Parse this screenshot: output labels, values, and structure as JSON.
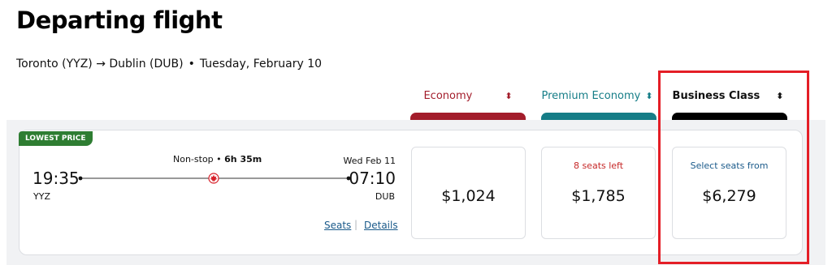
{
  "page": {
    "title": "Departing flight",
    "route": "Toronto (YYZ) → Dublin (DUB)",
    "route_sep": "•",
    "date": "Tuesday, February 10"
  },
  "columns": [
    {
      "label": "Economy",
      "sort_icon": "sort-updown-icon",
      "color": "#a31d2b"
    },
    {
      "label": "Premium Economy",
      "sort_icon": "sort-updown-icon",
      "color": "#157d87"
    },
    {
      "label": "Business Class",
      "sort_icon": "sort-updown-icon",
      "color": "#000000"
    }
  ],
  "flight": {
    "badge": "LOWEST PRICE",
    "stops": "Non-stop",
    "stops_sep": "•",
    "duration": "6h 35m",
    "arrival_date": "Wed Feb 11",
    "departure_time": "19:35",
    "departure_code": "YYZ",
    "arrival_time": "07:10",
    "arrival_code": "DUB",
    "airline_icon": "maple-leaf-icon",
    "links": {
      "seats": "Seats",
      "separator": "|",
      "details": "Details"
    }
  },
  "fares": [
    {
      "cabin": "Economy",
      "note": "",
      "price": "$1,024"
    },
    {
      "cabin": "Premium Economy",
      "note": "8 seats left",
      "price": "$1,785"
    },
    {
      "cabin": "Business Class",
      "note": "Select seats from",
      "price": "$6,279"
    }
  ],
  "colors": {
    "economy": "#a31d2b",
    "premium": "#157d87",
    "business": "#000000",
    "badge": "#2e7d32",
    "highlight": "#e41e26",
    "seats_left": "#c62828",
    "link": "#1a5a8a"
  }
}
